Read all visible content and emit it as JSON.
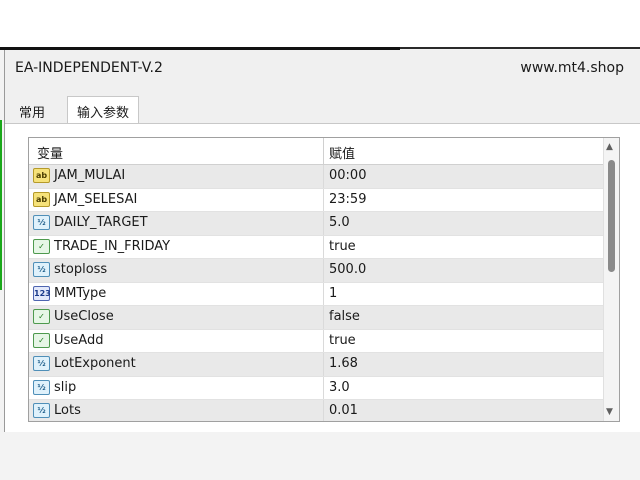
{
  "window": {
    "title": "EA-INDEPENDENT-V.2",
    "site": "www.mt4.shop"
  },
  "tabs": [
    {
      "label": "常用",
      "active": false
    },
    {
      "label": "输入参数",
      "active": true
    }
  ],
  "table": {
    "headers": {
      "variable": "变量",
      "value": "赋值"
    },
    "rows": [
      {
        "icon": "string-type-icon",
        "icon_text": "ab",
        "kind": "str",
        "name": "JAM_MULAI",
        "value": "00:00"
      },
      {
        "icon": "string-type-icon",
        "icon_text": "ab",
        "kind": "str",
        "name": "JAM_SELESAI",
        "value": "23:59"
      },
      {
        "icon": "double-type-icon",
        "icon_text": "½",
        "kind": "dbl",
        "name": "DAILY_TARGET",
        "value": "5.0"
      },
      {
        "icon": "bool-type-icon",
        "icon_text": "✓",
        "kind": "bool",
        "name": "TRADE_IN_FRIDAY",
        "value": "true"
      },
      {
        "icon": "double-type-icon",
        "icon_text": "½",
        "kind": "dbl",
        "name": "stoploss",
        "value": "500.0"
      },
      {
        "icon": "int-type-icon",
        "icon_text": "123",
        "kind": "int",
        "name": "MMType",
        "value": "1"
      },
      {
        "icon": "bool-type-icon",
        "icon_text": "✓",
        "kind": "bool",
        "name": "UseClose",
        "value": "false"
      },
      {
        "icon": "bool-type-icon",
        "icon_text": "✓",
        "kind": "bool",
        "name": "UseAdd",
        "value": "true"
      },
      {
        "icon": "double-type-icon",
        "icon_text": "½",
        "kind": "dbl",
        "name": "LotExponent",
        "value": "1.68"
      },
      {
        "icon": "double-type-icon",
        "icon_text": "½",
        "kind": "dbl",
        "name": "slip",
        "value": "3.0"
      },
      {
        "icon": "double-type-icon",
        "icon_text": "½",
        "kind": "dbl",
        "name": "Lots",
        "value": "0.01"
      }
    ]
  },
  "scrollbar": {
    "up_glyph": "▲",
    "down_glyph": "▼"
  }
}
